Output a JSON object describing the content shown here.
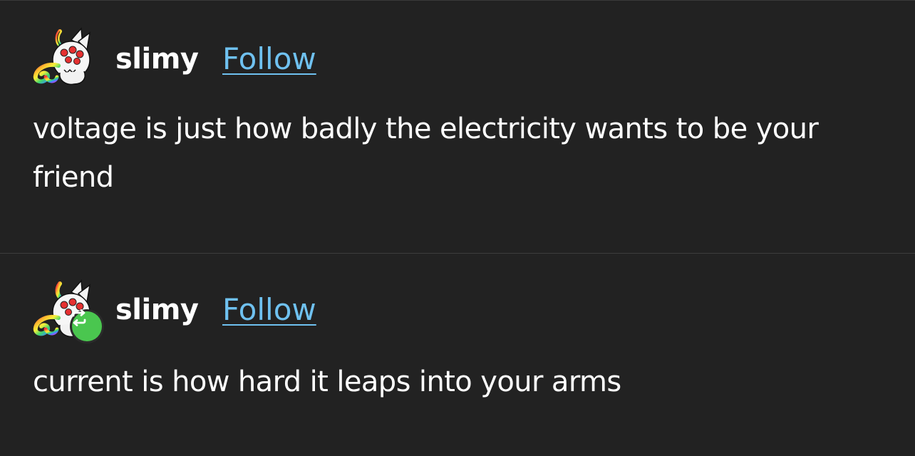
{
  "posts": [
    {
      "username": "slimy",
      "follow_label": "Follow",
      "text": "voltage is just how badly the electricity wants to be your friend",
      "reblogged": false
    },
    {
      "username": "slimy",
      "follow_label": "Follow",
      "text": "current is how hard it leaps into your arms",
      "reblogged": true
    }
  ],
  "colors": {
    "background": "#222222",
    "link": "#6fc1f0",
    "reblog_badge": "#4ac64f",
    "divider": "#3e3e3e"
  },
  "icons": {
    "avatar": "creature-avatar-icon",
    "reblog": "reblog-icon"
  }
}
